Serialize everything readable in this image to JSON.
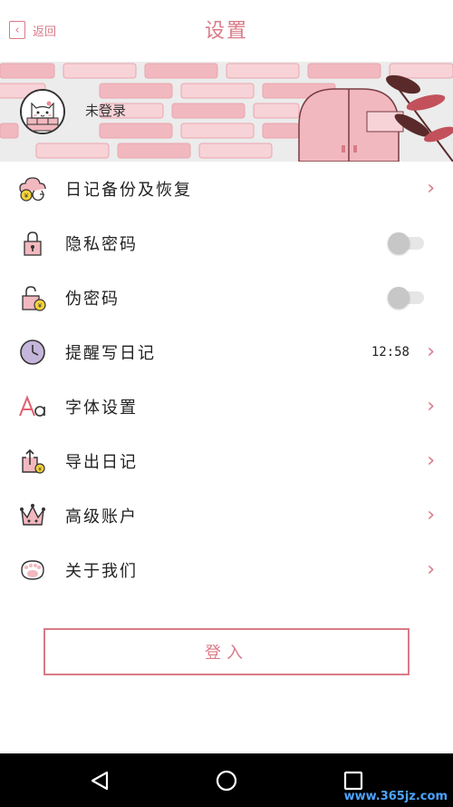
{
  "header": {
    "back_label": "返回",
    "title": "设置"
  },
  "profile": {
    "status": "未登录"
  },
  "settings": {
    "items": [
      {
        "label": "日记备份及恢复",
        "icon": "cloud-backup-icon",
        "control": "chevron"
      },
      {
        "label": "隐私密码",
        "icon": "lock-icon",
        "control": "toggle",
        "enabled": false
      },
      {
        "label": "伪密码",
        "icon": "fake-lock-icon",
        "control": "toggle",
        "enabled": false
      },
      {
        "label": "提醒写日记",
        "icon": "clock-icon",
        "control": "chevron",
        "value": "12:58"
      },
      {
        "label": "字体设置",
        "icon": "font-icon",
        "control": "chevron"
      },
      {
        "label": "导出日记",
        "icon": "export-icon",
        "control": "chevron"
      },
      {
        "label": "高级账户",
        "icon": "crown-icon",
        "control": "chevron"
      },
      {
        "label": "关于我们",
        "icon": "paw-icon",
        "control": "chevron"
      }
    ]
  },
  "login_button": {
    "label": "登入"
  },
  "nav": {
    "back": "back-triangle-icon",
    "home": "home-circle-icon",
    "recents": "recents-square-icon"
  },
  "watermark": "www.365jz.com",
  "colors": {
    "accent": "#d97b88",
    "brick": "#f2b8bf",
    "navbar": "#000000"
  }
}
